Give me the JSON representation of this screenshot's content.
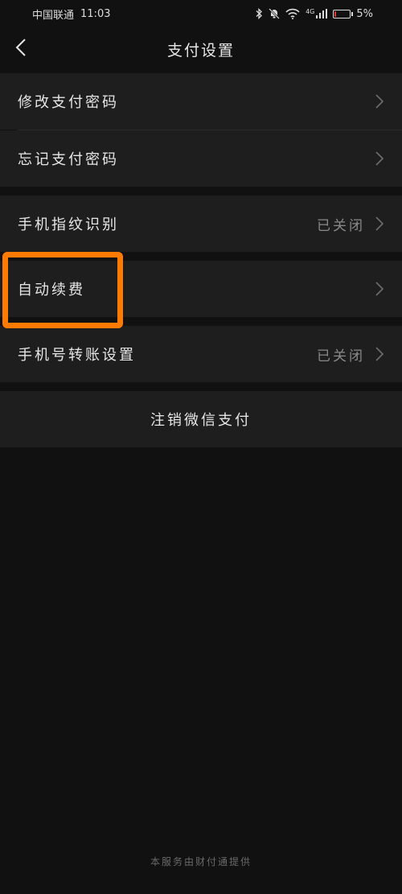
{
  "status_bar": {
    "carrier": "中国联通",
    "time": "11:03",
    "network": "4G",
    "battery": "5%",
    "battery_level": 0.05,
    "icons": [
      "bluetooth-icon",
      "mute-bell-icon",
      "wifi-icon",
      "signal-icon",
      "battery-icon"
    ]
  },
  "nav": {
    "title": "支付设置",
    "back_icon": "chevron-left-icon"
  },
  "groups": [
    {
      "items": [
        {
          "label": "修改支付密码",
          "value": ""
        },
        {
          "label": "忘记支付密码",
          "value": ""
        }
      ]
    },
    {
      "items": [
        {
          "label": "手机指纹识别",
          "value": "已关闭"
        }
      ]
    },
    {
      "items": [
        {
          "label": "自动续费",
          "value": ""
        }
      ]
    },
    {
      "items": [
        {
          "label": "手机号转账设置",
          "value": "已关闭"
        }
      ]
    },
    {
      "items": [
        {
          "label": "注销微信支付",
          "value": ""
        }
      ]
    }
  ],
  "footer": "本服务由财付通提供",
  "colors": {
    "background": "#111111",
    "row": "#1e1e1e",
    "highlight": "#ff7a00",
    "battery_low": "#e53935"
  }
}
